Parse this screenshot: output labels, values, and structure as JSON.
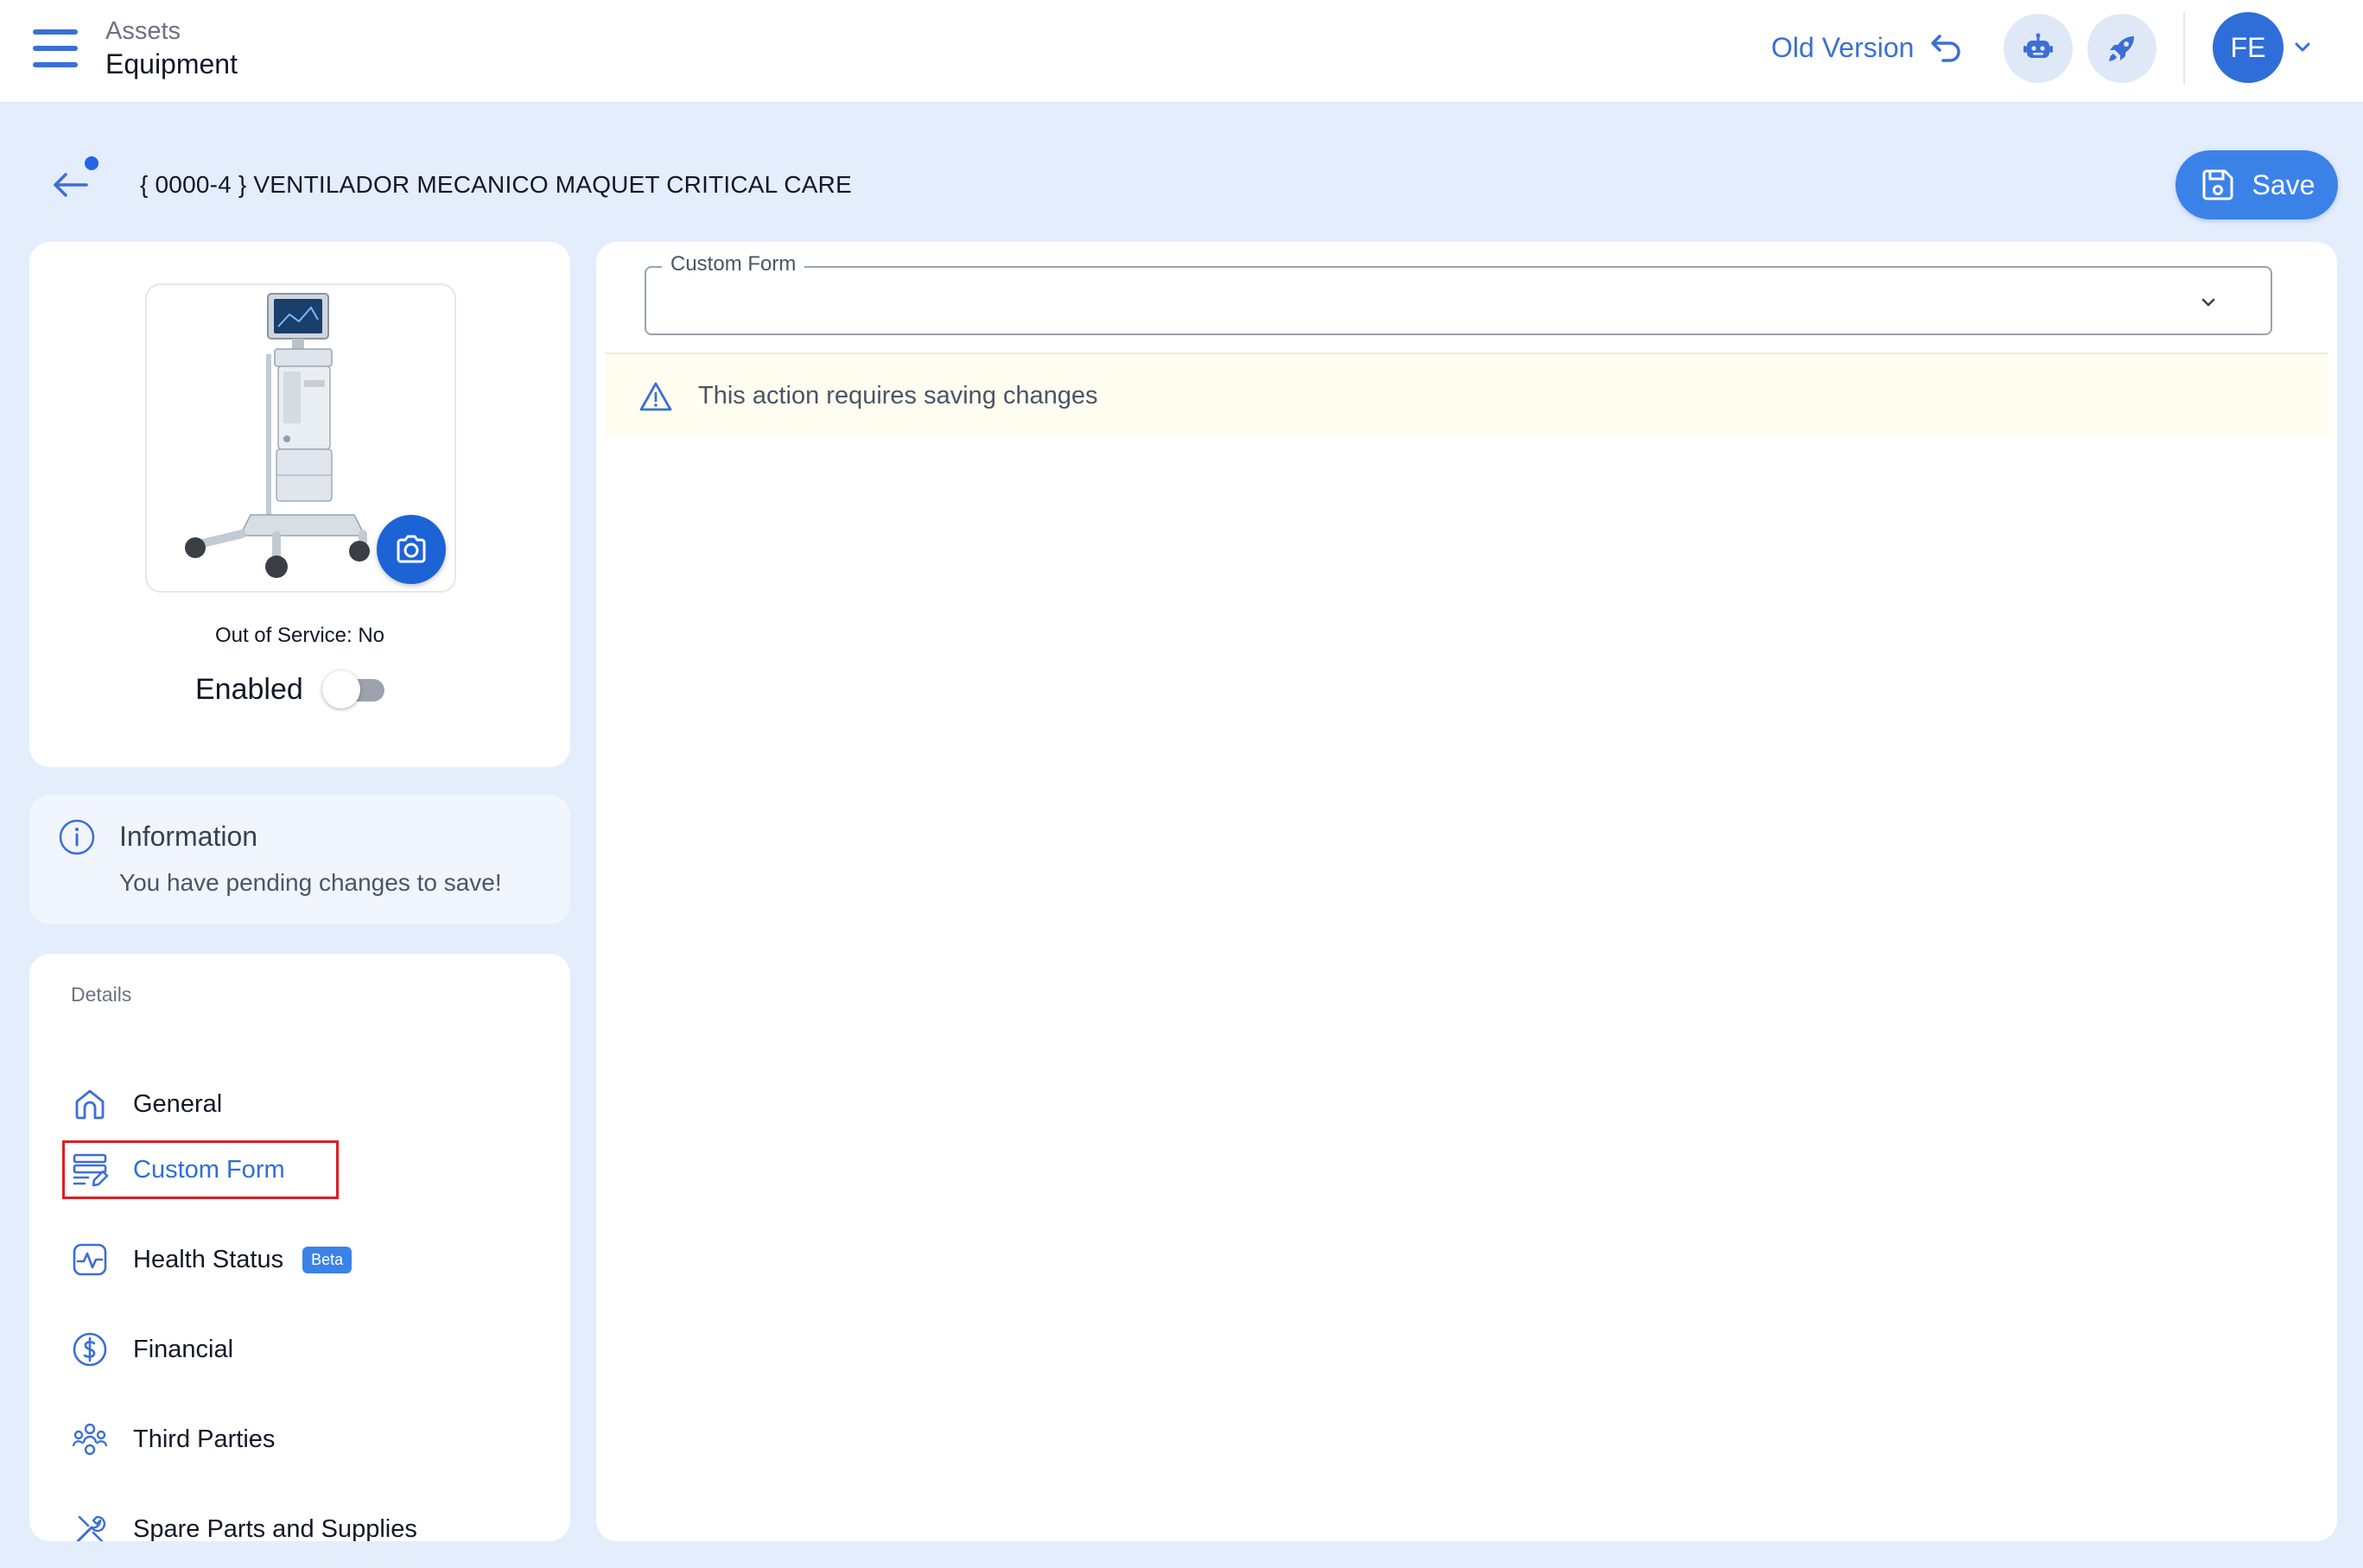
{
  "topbar": {
    "breadcrumb_parent": "Assets",
    "breadcrumb_current": "Equipment",
    "old_version_label": "Old Version",
    "user_initials": "FE"
  },
  "header": {
    "title": "{ 0000-4 } VENTILADOR MECANICO MAQUET CRITICAL CARE",
    "save_label": "Save"
  },
  "equipment_card": {
    "out_of_service": "Out of Service: No",
    "enabled_label": "Enabled",
    "enabled": false
  },
  "info_card": {
    "title": "Information",
    "message": "You have pending changes to save!"
  },
  "details": {
    "heading": "Details",
    "items": [
      {
        "label": "General",
        "icon": "home-icon"
      },
      {
        "label": "Custom Form",
        "icon": "form-edit-icon",
        "active": true
      },
      {
        "label": "Health Status",
        "icon": "pulse-icon",
        "badge": "Beta"
      },
      {
        "label": "Financial",
        "icon": "dollar-icon"
      },
      {
        "label": "Third Parties",
        "icon": "people-icon"
      },
      {
        "label": "Spare Parts and Supplies",
        "icon": "tools-icon"
      }
    ]
  },
  "main": {
    "custom_form_label": "Custom Form",
    "custom_form_value": "",
    "warning": "This action requires saving changes"
  },
  "colors": {
    "accent": "#3b82e8",
    "page_background": "#e4edfb",
    "highlight": "#e21b23",
    "warning_background": "#fffdf0"
  }
}
